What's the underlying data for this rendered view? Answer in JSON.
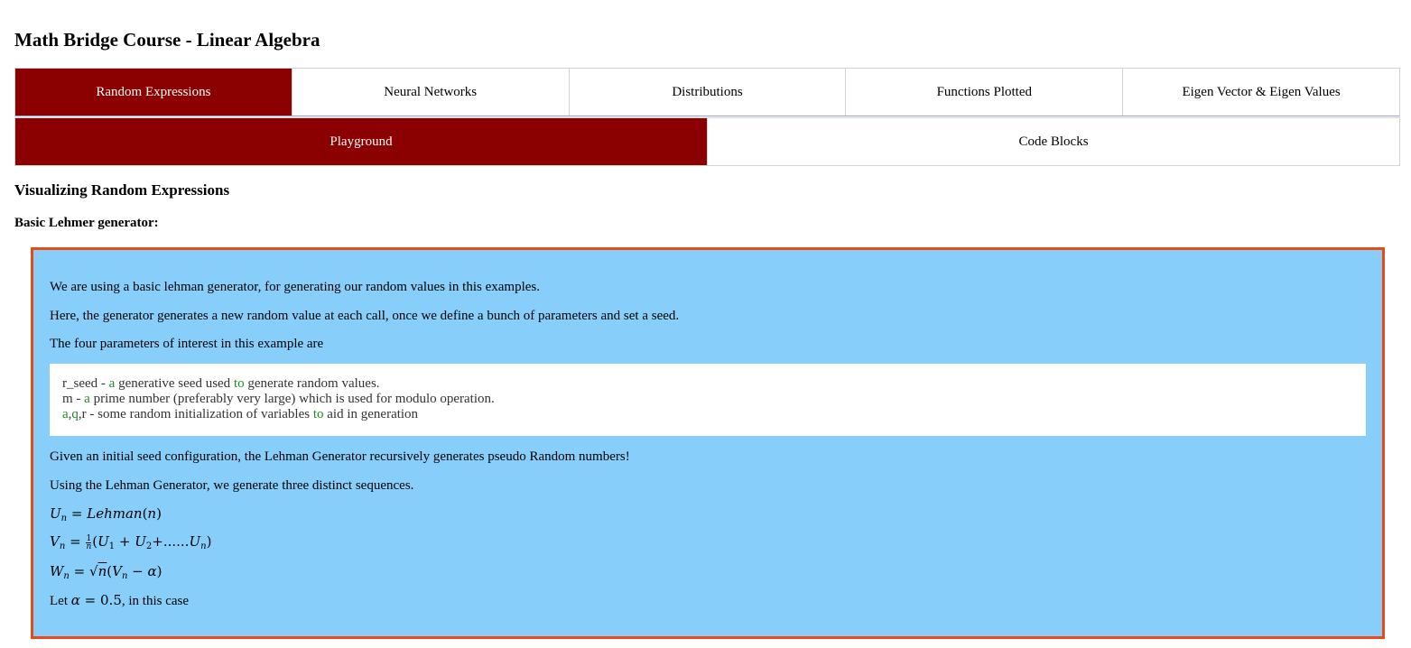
{
  "page": {
    "title": "Math Bridge Course - Linear Algebra"
  },
  "primary_tabs": [
    {
      "label": "Random Expressions",
      "active": true
    },
    {
      "label": "Neural Networks",
      "active": false
    },
    {
      "label": "Distributions",
      "active": false
    },
    {
      "label": "Functions Plotted",
      "active": false
    },
    {
      "label": "Eigen Vector & Eigen Values",
      "active": false
    }
  ],
  "secondary_tabs": [
    {
      "label": "Playground",
      "active": true
    },
    {
      "label": "Code Blocks",
      "active": false
    }
  ],
  "section": {
    "heading": "Visualizing Random Expressions",
    "subheading": "Basic Lehmer generator:"
  },
  "panel": {
    "intro_1": "We are using a basic lehman generator, for generating our random values in this examples.",
    "intro_2": "Here, the generator generates a new random value at each call, once we define a bunch of parameters and set a seed.",
    "intro_3": "The four parameters of interest in this example are",
    "code": {
      "line_1_a": "r_seed - ",
      "line_1_kw1": "a",
      "line_1_b": " generative seed used ",
      "line_1_kw2": "to",
      "line_1_c": " generate random values.",
      "line_2_a": "m - ",
      "line_2_kw1": "a",
      "line_2_b": " prime number (preferably very large) which is used for modulo operation.",
      "line_3_kw1": "a",
      "line_3_sep1": ",",
      "line_3_kw2": "q",
      "line_3_b": ",r - some random initialization of variables ",
      "line_3_kw3": "to",
      "line_3_c": " aid in generation"
    },
    "after_1": "Given an initial seed configuration, the Lehman Generator recursively generates pseudo Random numbers!",
    "after_2": "Using the Lehman Generator, we generate three distinct sequences.",
    "alpha_prefix": "Let ",
    "alpha_value": "0.5",
    "alpha_suffix": ", in this case"
  },
  "colors": {
    "active_tab": "#8b0000",
    "panel_bg": "#87cefa",
    "panel_border": "#e64a19",
    "keyword": "#228b22"
  }
}
